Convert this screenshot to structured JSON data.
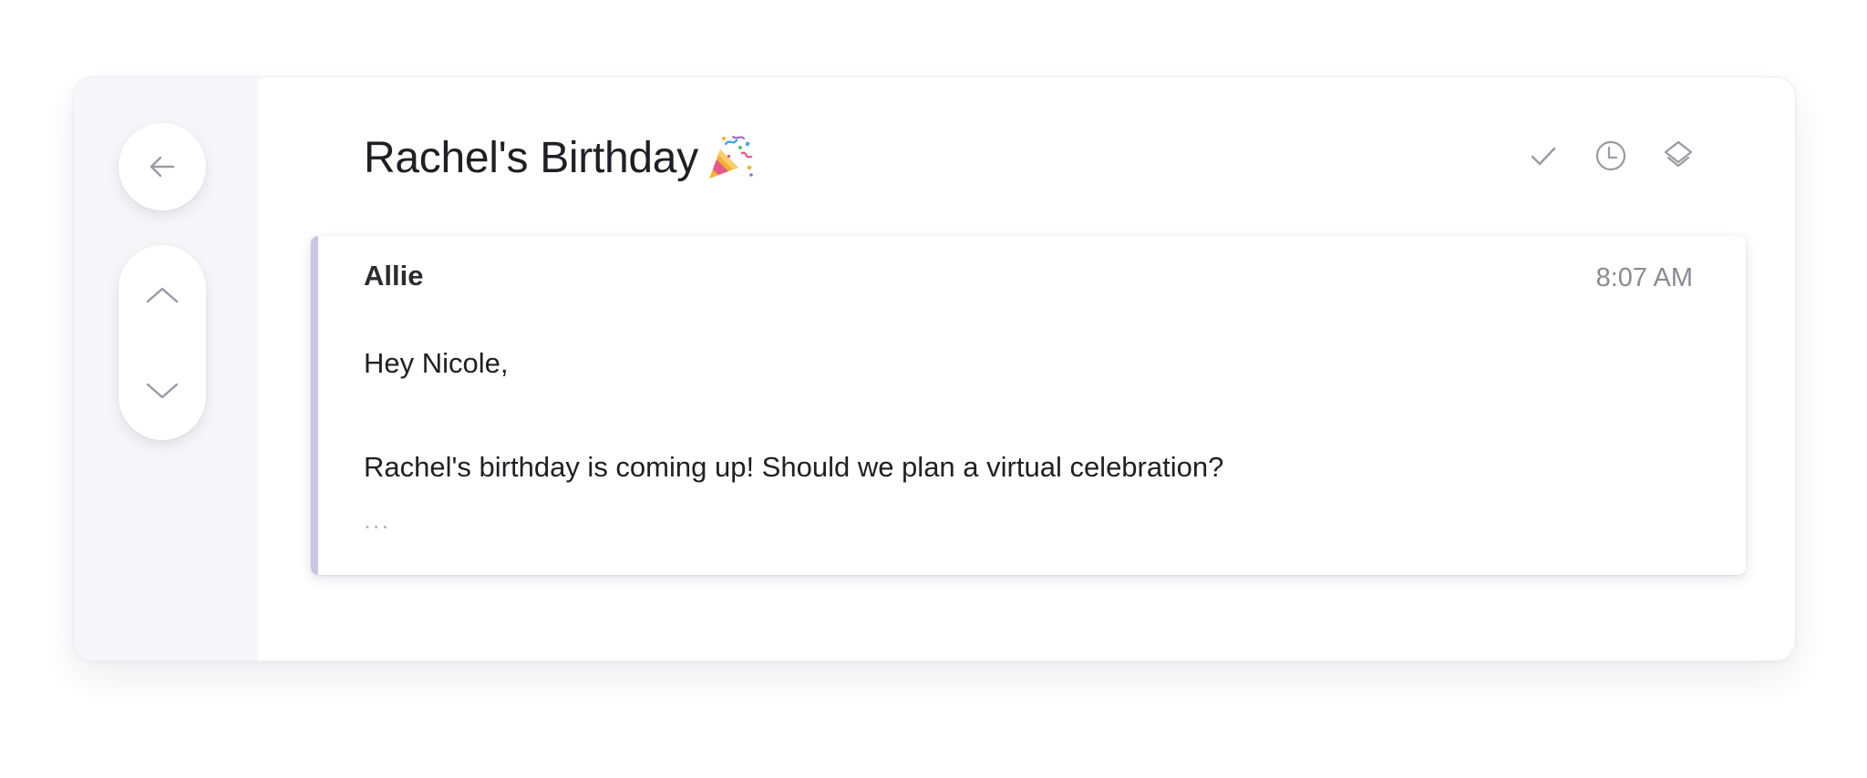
{
  "thread": {
    "title": "Rachel's Birthday",
    "title_emoji": "party-popper-icon"
  },
  "nav": {
    "back_icon": "arrow-left-icon",
    "up_icon": "chevron-up-icon",
    "down_icon": "chevron-down-icon"
  },
  "actions": [
    {
      "icon": "checkmark-icon"
    },
    {
      "icon": "clock-icon"
    },
    {
      "icon": "layers-icon"
    }
  ],
  "message": {
    "sender": "Allie",
    "time": "8:07 AM",
    "greeting": "Hey Nicole,",
    "body": "Rachel's birthday is coming up! Should we plan a virtual celebration?",
    "expand": "..."
  },
  "colors": {
    "accent": "#c9c5e3",
    "icon": "#9a9aa3"
  }
}
